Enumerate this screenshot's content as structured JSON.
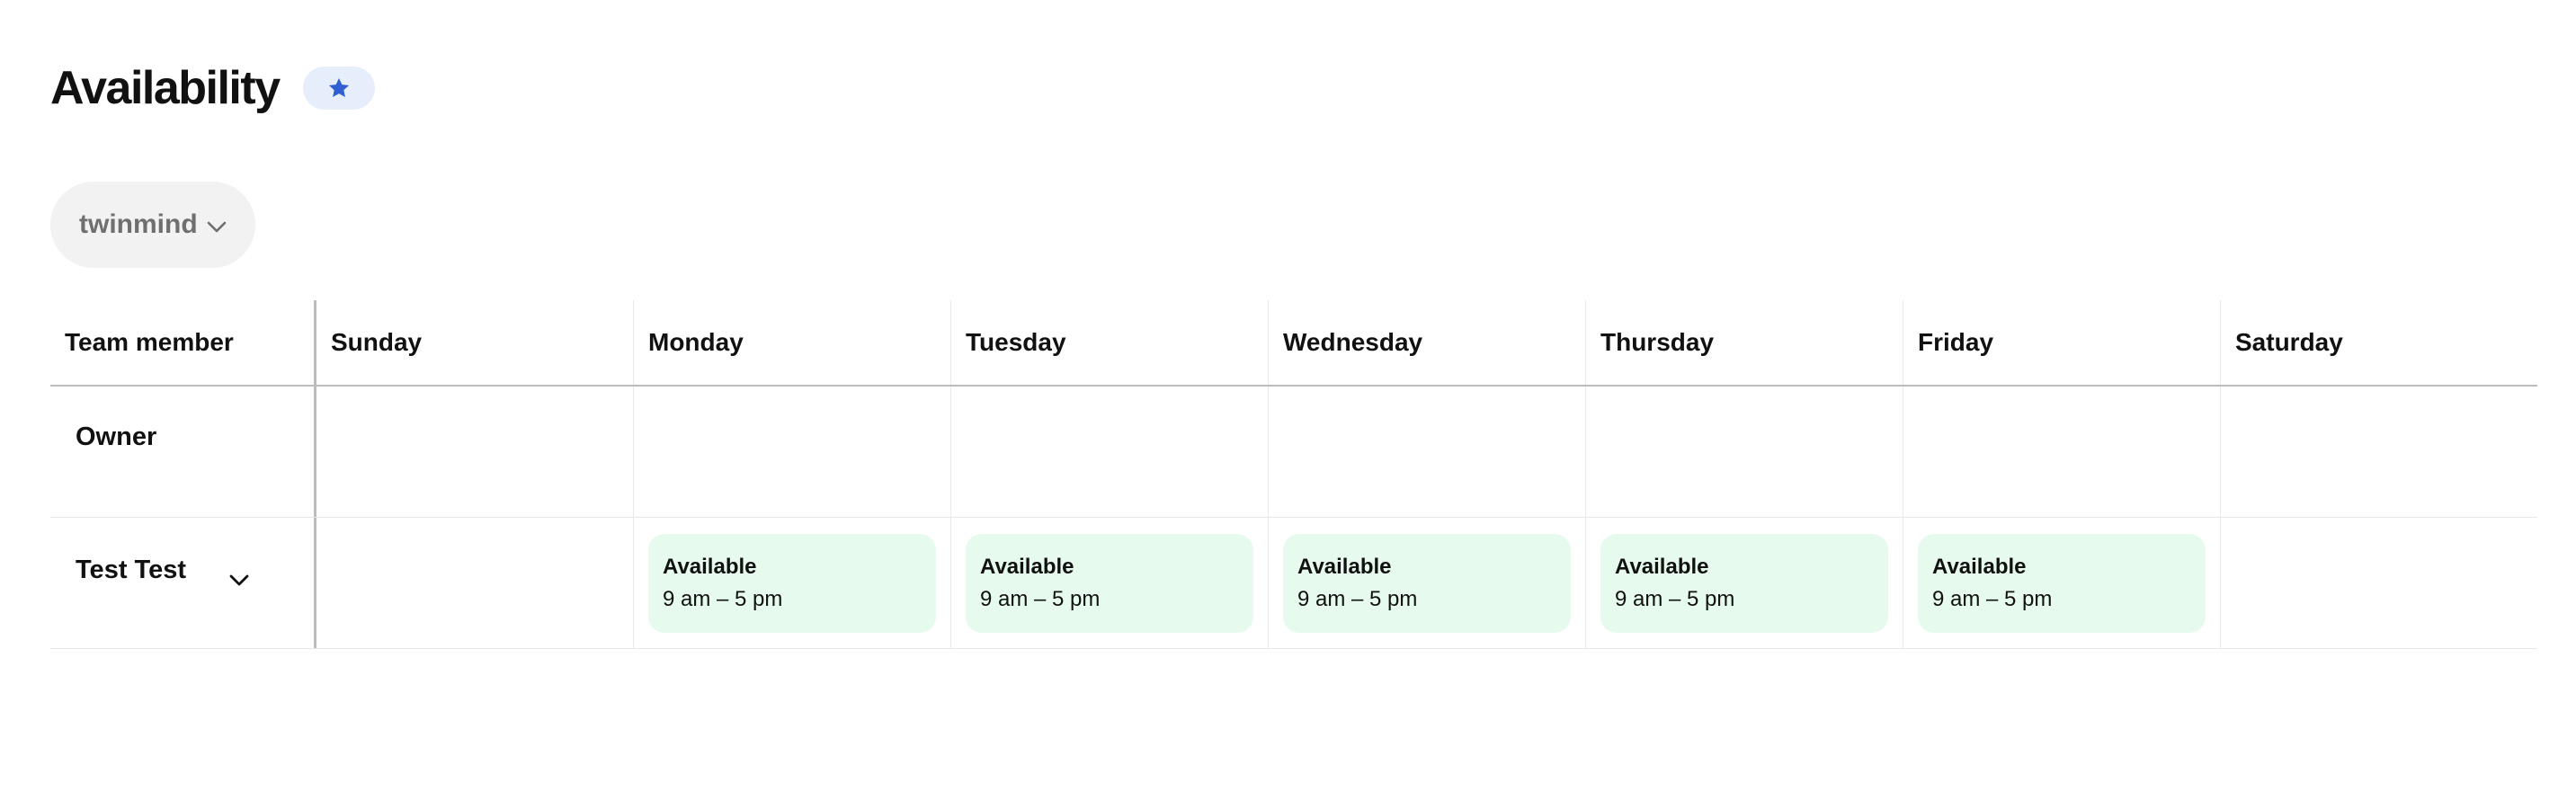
{
  "header": {
    "title": "Availability",
    "badge_icon": "star-icon",
    "badge_color": "#2f5fd0",
    "badge_bg": "#e6edfb"
  },
  "team_selector": {
    "value": "twinmind",
    "icon": "chevron-down-icon"
  },
  "schedule": {
    "columns": [
      "Team member",
      "Sunday",
      "Monday",
      "Tuesday",
      "Wednesday",
      "Thursday",
      "Friday",
      "Saturday"
    ],
    "rows": [
      {
        "member": "Owner",
        "days": []
      },
      {
        "member": "Test Test",
        "expand_icon": "chevron-down-icon",
        "days": [
          {
            "day": "Monday",
            "status": "Available",
            "hours": "9 am – 5 pm"
          },
          {
            "day": "Tuesday",
            "status": "Available",
            "hours": "9 am – 5 pm"
          },
          {
            "day": "Wednesday",
            "status": "Available",
            "hours": "9 am – 5 pm"
          },
          {
            "day": "Thursday",
            "status": "Available",
            "hours": "9 am – 5 pm"
          },
          {
            "day": "Friday",
            "status": "Available",
            "hours": "9 am – 5 pm"
          }
        ]
      }
    ],
    "available_color": "#e6fbee"
  }
}
